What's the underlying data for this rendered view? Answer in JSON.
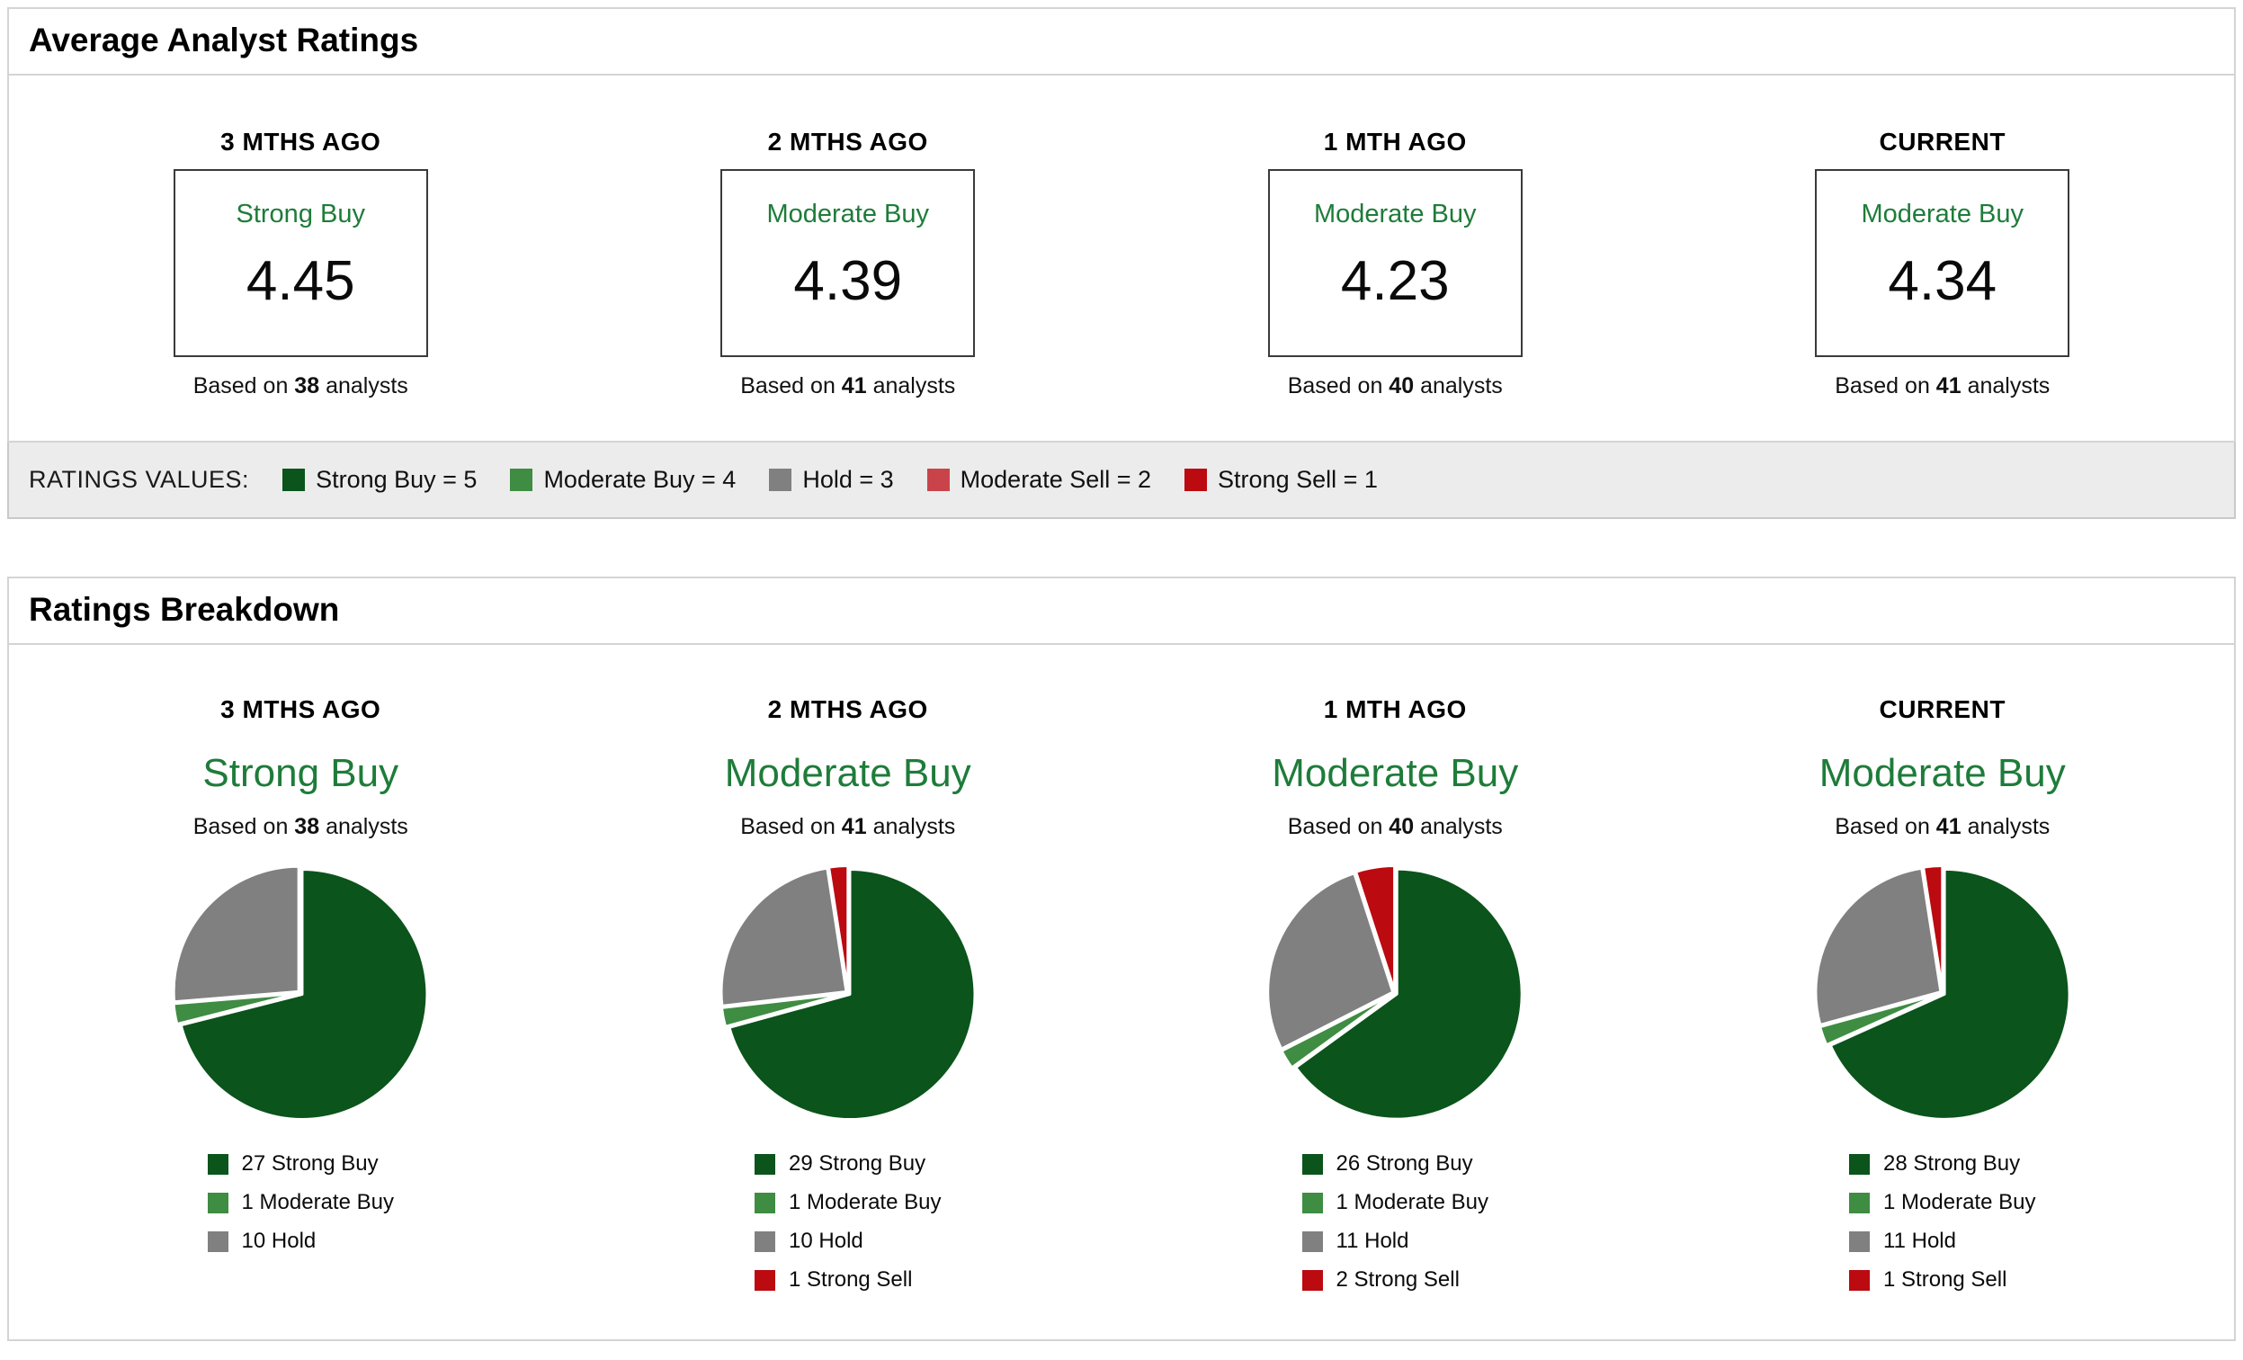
{
  "colors": {
    "strong_buy": "#0B541B",
    "moderate_buy": "#3F8C43",
    "hold": "#808080",
    "moderate_sell": "#C9444A",
    "strong_sell": "#BB0A10",
    "rating_text_green": "#1E7C3A"
  },
  "avg_panel": {
    "title": "Average Analyst Ratings",
    "cards": [
      {
        "period": "3 MTHS AGO",
        "rating": "Strong Buy",
        "value": "4.45",
        "based_prefix": "Based on",
        "analysts": "38",
        "based_suffix": "analysts"
      },
      {
        "period": "2 MTHS AGO",
        "rating": "Moderate Buy",
        "value": "4.39",
        "based_prefix": "Based on",
        "analysts": "41",
        "based_suffix": "analysts"
      },
      {
        "period": "1 MTH AGO",
        "rating": "Moderate Buy",
        "value": "4.23",
        "based_prefix": "Based on",
        "analysts": "40",
        "based_suffix": "analysts"
      },
      {
        "period": "CURRENT",
        "rating": "Moderate Buy",
        "value": "4.34",
        "based_prefix": "Based on",
        "analysts": "41",
        "based_suffix": "analysts"
      }
    ]
  },
  "ratings_values": {
    "label": "RATINGS VALUES:",
    "items": [
      {
        "label": "Strong Buy = 5",
        "color_key": "strong_buy"
      },
      {
        "label": "Moderate Buy = 4",
        "color_key": "moderate_buy"
      },
      {
        "label": "Hold = 3",
        "color_key": "hold"
      },
      {
        "label": "Moderate Sell = 2",
        "color_key": "moderate_sell"
      },
      {
        "label": "Strong Sell = 1",
        "color_key": "strong_sell"
      }
    ]
  },
  "breakdown_panel": {
    "title": "Ratings Breakdown",
    "cards": [
      {
        "period": "3 MTHS AGO",
        "rating": "Strong Buy",
        "based_prefix": "Based on",
        "analysts": "38",
        "based_suffix": "analysts",
        "slices": [
          {
            "label": "27 Strong Buy",
            "value": 27,
            "color_key": "strong_buy"
          },
          {
            "label": "1 Moderate Buy",
            "value": 1,
            "color_key": "moderate_buy"
          },
          {
            "label": "10 Hold",
            "value": 10,
            "color_key": "hold"
          }
        ]
      },
      {
        "period": "2 MTHS AGO",
        "rating": "Moderate Buy",
        "based_prefix": "Based on",
        "analysts": "41",
        "based_suffix": "analysts",
        "slices": [
          {
            "label": "29 Strong Buy",
            "value": 29,
            "color_key": "strong_buy"
          },
          {
            "label": "1 Moderate Buy",
            "value": 1,
            "color_key": "moderate_buy"
          },
          {
            "label": "10 Hold",
            "value": 10,
            "color_key": "hold"
          },
          {
            "label": "1 Strong Sell",
            "value": 1,
            "color_key": "strong_sell"
          }
        ]
      },
      {
        "period": "1 MTH AGO",
        "rating": "Moderate Buy",
        "based_prefix": "Based on",
        "analysts": "40",
        "based_suffix": "analysts",
        "slices": [
          {
            "label": "26 Strong Buy",
            "value": 26,
            "color_key": "strong_buy"
          },
          {
            "label": "1 Moderate Buy",
            "value": 1,
            "color_key": "moderate_buy"
          },
          {
            "label": "11 Hold",
            "value": 11,
            "color_key": "hold"
          },
          {
            "label": "2 Strong Sell",
            "value": 2,
            "color_key": "strong_sell"
          }
        ]
      },
      {
        "period": "CURRENT",
        "rating": "Moderate Buy",
        "based_prefix": "Based on",
        "analysts": "41",
        "based_suffix": "analysts",
        "slices": [
          {
            "label": "28 Strong Buy",
            "value": 28,
            "color_key": "strong_buy"
          },
          {
            "label": "1 Moderate Buy",
            "value": 1,
            "color_key": "moderate_buy"
          },
          {
            "label": "11 Hold",
            "value": 11,
            "color_key": "hold"
          },
          {
            "label": "1 Strong Sell",
            "value": 1,
            "color_key": "strong_sell"
          }
        ]
      }
    ]
  },
  "chart_data": [
    {
      "type": "table",
      "title": "Average Analyst Ratings",
      "columns": [
        "3 MTHS AGO",
        "2 MTHS AGO",
        "1 MTH AGO",
        "CURRENT"
      ],
      "rows": [
        [
          "Strong Buy",
          "Moderate Buy",
          "Moderate Buy",
          "Moderate Buy"
        ],
        [
          4.45,
          4.39,
          4.23,
          4.34
        ],
        [
          "Based on 38 analysts",
          "Based on 41 analysts",
          "Based on 40 analysts",
          "Based on 41 analysts"
        ]
      ],
      "note": "Ratings values: Strong Buy = 5, Moderate Buy = 4, Hold = 3, Moderate Sell = 2, Strong Sell = 1"
    },
    {
      "type": "pie",
      "title": "Ratings Breakdown — 3 MTHS AGO (Strong Buy, 38 analysts)",
      "categories": [
        "Strong Buy",
        "Moderate Buy",
        "Hold"
      ],
      "values": [
        27,
        1,
        10
      ],
      "legend_position": "bottom",
      "start_angle": 0,
      "direction": "clockwise"
    },
    {
      "type": "pie",
      "title": "Ratings Breakdown — 2 MTHS AGO (Moderate Buy, 41 analysts)",
      "categories": [
        "Strong Buy",
        "Moderate Buy",
        "Hold",
        "Strong Sell"
      ],
      "values": [
        29,
        1,
        10,
        1
      ],
      "legend_position": "bottom",
      "start_angle": 0,
      "direction": "clockwise"
    },
    {
      "type": "pie",
      "title": "Ratings Breakdown — 1 MTH AGO (Moderate Buy, 40 analysts)",
      "categories": [
        "Strong Buy",
        "Moderate Buy",
        "Hold",
        "Strong Sell"
      ],
      "values": [
        26,
        1,
        11,
        2
      ],
      "legend_position": "bottom",
      "start_angle": 0,
      "direction": "clockwise"
    },
    {
      "type": "pie",
      "title": "Ratings Breakdown — CURRENT (Moderate Buy, 41 analysts)",
      "categories": [
        "Strong Buy",
        "Moderate Buy",
        "Hold",
        "Strong Sell"
      ],
      "values": [
        28,
        1,
        11,
        1
      ],
      "legend_position": "bottom",
      "start_angle": 0,
      "direction": "clockwise"
    }
  ]
}
